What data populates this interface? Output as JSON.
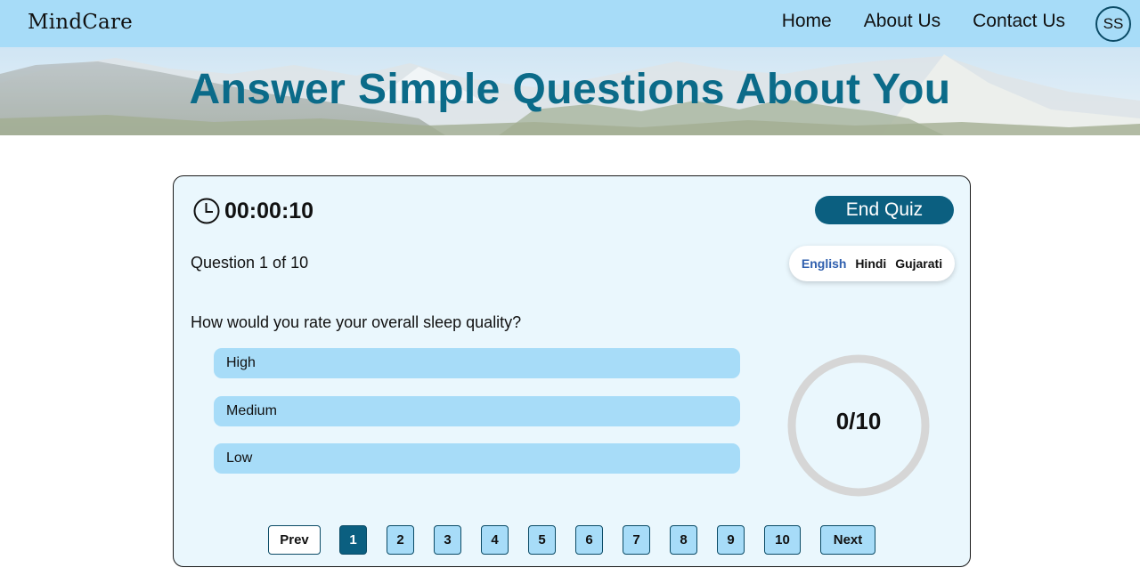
{
  "nav": {
    "brand": "MindCare",
    "links": [
      "Home",
      "About Us",
      "Contact Us"
    ],
    "avatar_initials": "SS"
  },
  "hero": {
    "title": "Answer Simple Questions About You"
  },
  "quiz": {
    "timer": "00:00:10",
    "end_label": "End Quiz",
    "question_counter": "Question 1 of 10",
    "languages": [
      "English",
      "Hindi",
      "Gujarati"
    ],
    "active_language": "English",
    "question": "How would you rate your overall sleep quality?",
    "options": [
      "High",
      "Medium",
      "Low"
    ],
    "score": "0/10",
    "pager": {
      "prev_label": "Prev",
      "next_label": "Next",
      "pages": [
        "1",
        "2",
        "3",
        "4",
        "5",
        "6",
        "7",
        "8",
        "9",
        "10"
      ],
      "current": "1"
    }
  },
  "colors": {
    "nav_bg": "#a7dcf8",
    "title": "#0b6b89",
    "accent": "#0b5f80",
    "card_bg": "#eaf7fd",
    "option_bg": "#a7dcf8",
    "ring": "#d6d6d6",
    "active_lang": "#2f5fae"
  },
  "icons": {
    "timer": "clock-icon"
  }
}
